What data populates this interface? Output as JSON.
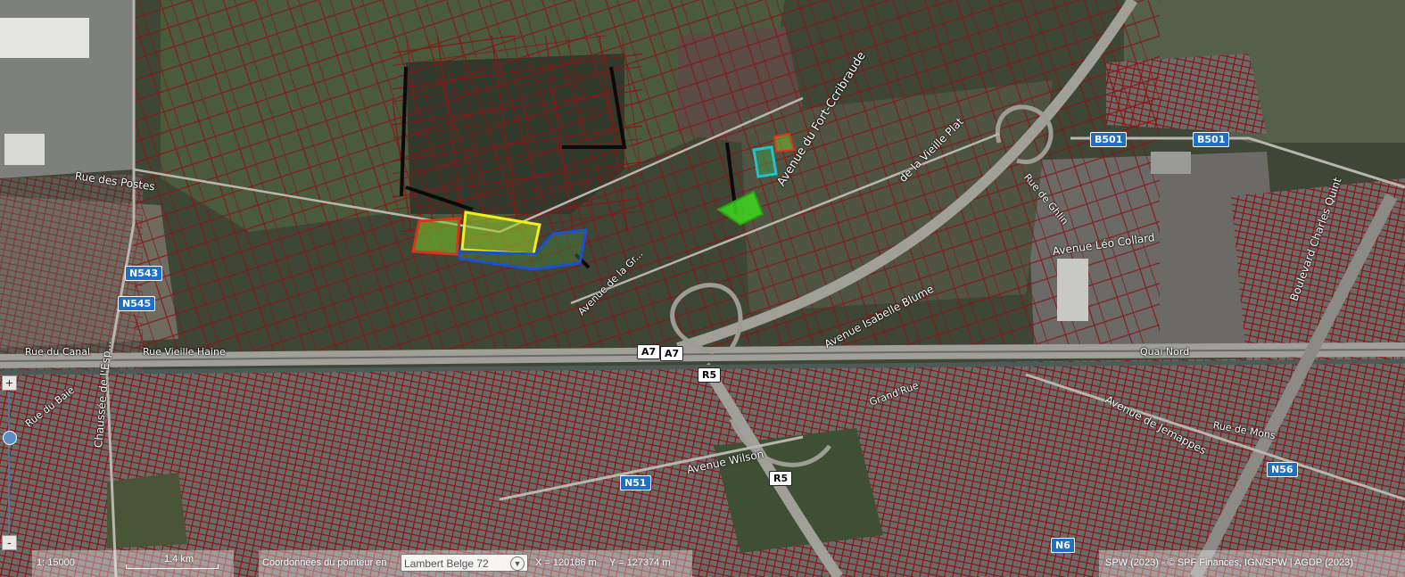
{
  "map": {
    "colors": {
      "background": "#3c4435",
      "parcel_lines": "#8b1414",
      "urban_fill": "#6e6e6a",
      "highway": "#9a9a94",
      "selection_yellow": "#f2ee1c",
      "selection_blue": "#1a4fd6",
      "selection_red": "#e0321a",
      "selection_green": "#3cd81e",
      "selection_cyan": "#20c4c4"
    },
    "labels": {
      "rue_des_postes": "Rue des Postes",
      "rue_du_canal": "Rue du Canal",
      "rue_vieille_haine": "Rue Vieille Haine",
      "chaussee_esp": "Chaussée de l'Esp...",
      "avenue_fort_ccribra": "Avenue du Fort-Ccribraude",
      "rue_vieille_plat": "de la Vieille Plat",
      "avenue_leo_collard": "Avenue Léo Collard",
      "avenue_isabelle": "Avenue Isabelle Blume",
      "avenue_wilson": "Avenue Wilson",
      "avenue_jemappes": "Avenue de Jemappes",
      "boulevard_charles_quint": "Boulevard Charles Quint",
      "quai_nord": "Quai Nord",
      "rue_du_ba": "Rue du Baie",
      "grand_rue": "Grand'Rue",
      "avenue_de_la_gr": "Avenue de la Gr...",
      "rue_de_ghlin": "Rue de Ghlin",
      "rue_de_mons": "Rue de Mons"
    },
    "shields": {
      "a7_1": "A7",
      "a7_2": "A7",
      "r5_1": "R5",
      "r5_2": "R5",
      "b501_1": "B501",
      "b501_2": "B501",
      "n543": "N543",
      "n545": "N545",
      "n51": "N51",
      "n56": "N56",
      "n6": "N6"
    }
  },
  "zoom": {
    "plus": "+",
    "minus": "-",
    "level_fraction": 0.68
  },
  "bottom_bar": {
    "scale_ratio": "1: 15000",
    "scale_length": "1.4 km",
    "coords_label": "Coordonnées du pointeur en",
    "crs_value": "Lambert Belge 72",
    "x_readout": "X = 120186 m",
    "y_readout": "Y = 127374 m",
    "attribution": "SPW (2023) - © SPF Finances, IGN/SPW | AGDP (2023)"
  }
}
